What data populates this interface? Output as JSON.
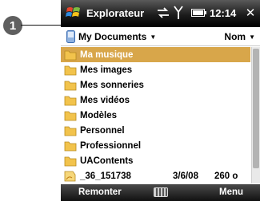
{
  "callout": {
    "number": "1"
  },
  "titlebar": {
    "title": "Explorateur",
    "time": "12:14",
    "close": "✕"
  },
  "header": {
    "folder": "My Documents",
    "sort": "Nom"
  },
  "files": [
    {
      "name": "Ma musique",
      "type": "folder",
      "selected": true
    },
    {
      "name": "Mes images",
      "type": "folder"
    },
    {
      "name": "Mes sonneries",
      "type": "folder"
    },
    {
      "name": "Mes vidéos",
      "type": "folder"
    },
    {
      "name": "Modèles",
      "type": "folder"
    },
    {
      "name": "Personnel",
      "type": "folder"
    },
    {
      "name": "Professionnel",
      "type": "folder"
    },
    {
      "name": "UAContents",
      "type": "folder"
    },
    {
      "name": "_36_151738",
      "type": "file",
      "date": "3/6/08",
      "size": "260 o"
    }
  ],
  "softkeys": {
    "left": "Remonter",
    "right": "Menu"
  },
  "colors": {
    "selection": "#d8a64a",
    "folder": "#f2c34c",
    "titlebar": "#1c1c1c"
  }
}
